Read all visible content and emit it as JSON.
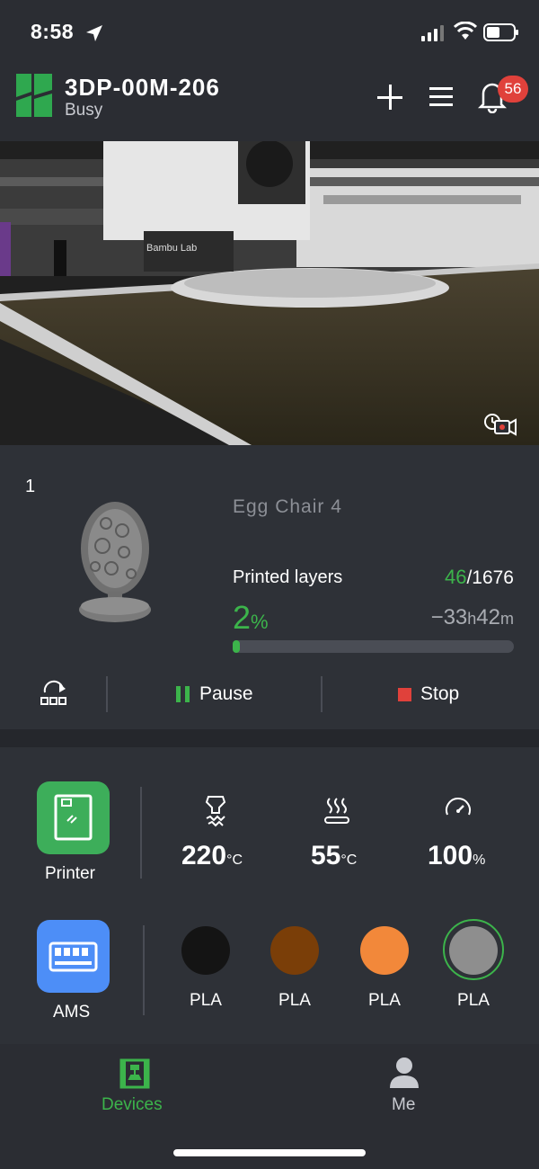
{
  "status_bar": {
    "time": "8:58",
    "icons": [
      "location-arrow-icon",
      "signal-icon",
      "wifi-icon",
      "battery-icon"
    ]
  },
  "header": {
    "device_name": "3DP-00M-206",
    "device_status": "Busy",
    "notification_count": "56",
    "icons": [
      "logo-icon",
      "plus-icon",
      "menu-icon",
      "bell-icon"
    ]
  },
  "camera": {
    "printer_brand_text": "Bambu Lab",
    "record_icon": "record-video-icon"
  },
  "job": {
    "plate_number": "1",
    "name": "Egg Chair 4",
    "layers_label": "Printed layers",
    "layers_current": "46",
    "layers_total": "/1676",
    "progress_percent": "2",
    "percent_unit": "%",
    "progress_fraction": 0.02,
    "remaining_prefix": "−33",
    "remaining_hours_unit": "h",
    "remaining_minutes": "42",
    "remaining_minutes_unit": "m",
    "controls": {
      "pause_label": "Pause",
      "stop_label": "Stop"
    }
  },
  "status": {
    "printer_label": "Printer",
    "nozzle_temp": "220",
    "bed_temp": "55",
    "temp_unit": "°C",
    "speed": "100",
    "speed_unit": "%",
    "ams_label": "AMS",
    "spools": [
      {
        "material": "PLA",
        "color": "#141414"
      },
      {
        "material": "PLA",
        "color": "#7a3e08"
      },
      {
        "material": "PLA",
        "color": "#f2883a"
      },
      {
        "material": "PLA",
        "color": "#8e8e8e",
        "selected": true
      }
    ]
  },
  "tabs": {
    "devices_label": "Devices",
    "me_label": "Me"
  },
  "colors": {
    "accent_green": "#3cb44b",
    "stop_red": "#e0413b",
    "ams_blue": "#4d8ef7",
    "background": "#2b2d33"
  }
}
